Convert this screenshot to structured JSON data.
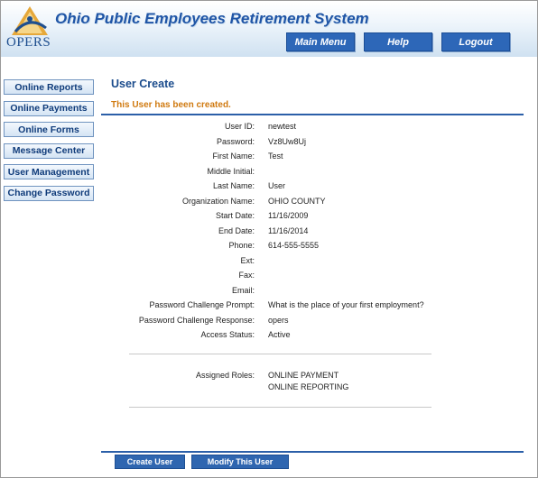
{
  "header": {
    "logo_text": "OPERS",
    "site_title": "Ohio Public Employees Retirement System",
    "nav": [
      {
        "label": "Main Menu"
      },
      {
        "label": "Help"
      },
      {
        "label": "Logout"
      }
    ]
  },
  "sidebar": {
    "items": [
      {
        "label": "Online Reports"
      },
      {
        "label": "Online Payments"
      },
      {
        "label": "Online Forms"
      },
      {
        "label": "Message Center"
      },
      {
        "label": "User Management"
      },
      {
        "label": "Change Password"
      }
    ]
  },
  "main": {
    "title": "User Create",
    "success_message": "This User has been created.",
    "fields": [
      {
        "label": "User ID:",
        "value": "newtest"
      },
      {
        "label": "Password:",
        "value": "Vz8Uw8Uj"
      },
      {
        "label": "First Name:",
        "value": "Test"
      },
      {
        "label": "Middle Initial:",
        "value": ""
      },
      {
        "label": "Last Name:",
        "value": "User"
      },
      {
        "label": "Organization Name:",
        "value": "OHIO COUNTY"
      },
      {
        "label": "Start Date:",
        "value": "11/16/2009"
      },
      {
        "label": "End Date:",
        "value": "11/16/2014"
      },
      {
        "label": "Phone:",
        "value": "614-555-5555"
      },
      {
        "label": "Ext:",
        "value": ""
      },
      {
        "label": "Fax:",
        "value": ""
      },
      {
        "label": "Email:",
        "value": ""
      },
      {
        "label": "Password Challenge Prompt:",
        "value": "What is the place of your first employment?"
      },
      {
        "label": "Password Challenge Response:",
        "value": "opers"
      },
      {
        "label": "Access Status:",
        "value": "Active"
      }
    ],
    "roles": {
      "label": "Assigned Roles:",
      "values": [
        "ONLINE PAYMENT",
        "ONLINE REPORTING"
      ]
    },
    "actions": {
      "create_label": "Create User",
      "modify_label": "Modify This User"
    }
  }
}
